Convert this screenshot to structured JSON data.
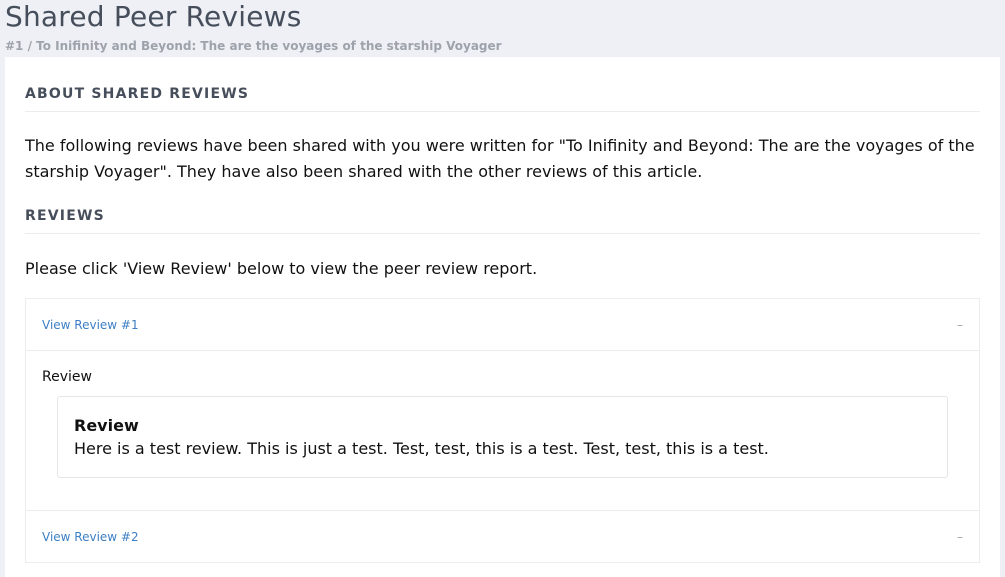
{
  "page": {
    "title": "Shared Peer Reviews",
    "breadcrumb": "#1 / To Inifinity and Beyond: The are the voyages of the starship Voyager"
  },
  "about": {
    "heading": "ABOUT SHARED REVIEWS",
    "text": "The following reviews have been shared with you were written for \"To Inifinity and Beyond: The are the voyages of the starship Voyager\". They have also been shared with the other reviews of this article."
  },
  "reviews": {
    "heading": "REVIEWS",
    "instruction": "Please click 'View Review' below to view the peer review report.",
    "items": [
      {
        "link_label": "View Review #1",
        "toggle": "–",
        "field_label": "Review",
        "box_title": "Review",
        "box_text": "Here is a test review. This is just a test. Test, test, this is a test. Test, test, this is a test."
      },
      {
        "link_label": "View Review #2",
        "toggle": "–"
      }
    ]
  },
  "colors": {
    "background": "#eef0f5",
    "card": "#ffffff",
    "link": "#3d7fc4",
    "heading": "#474e5b"
  }
}
